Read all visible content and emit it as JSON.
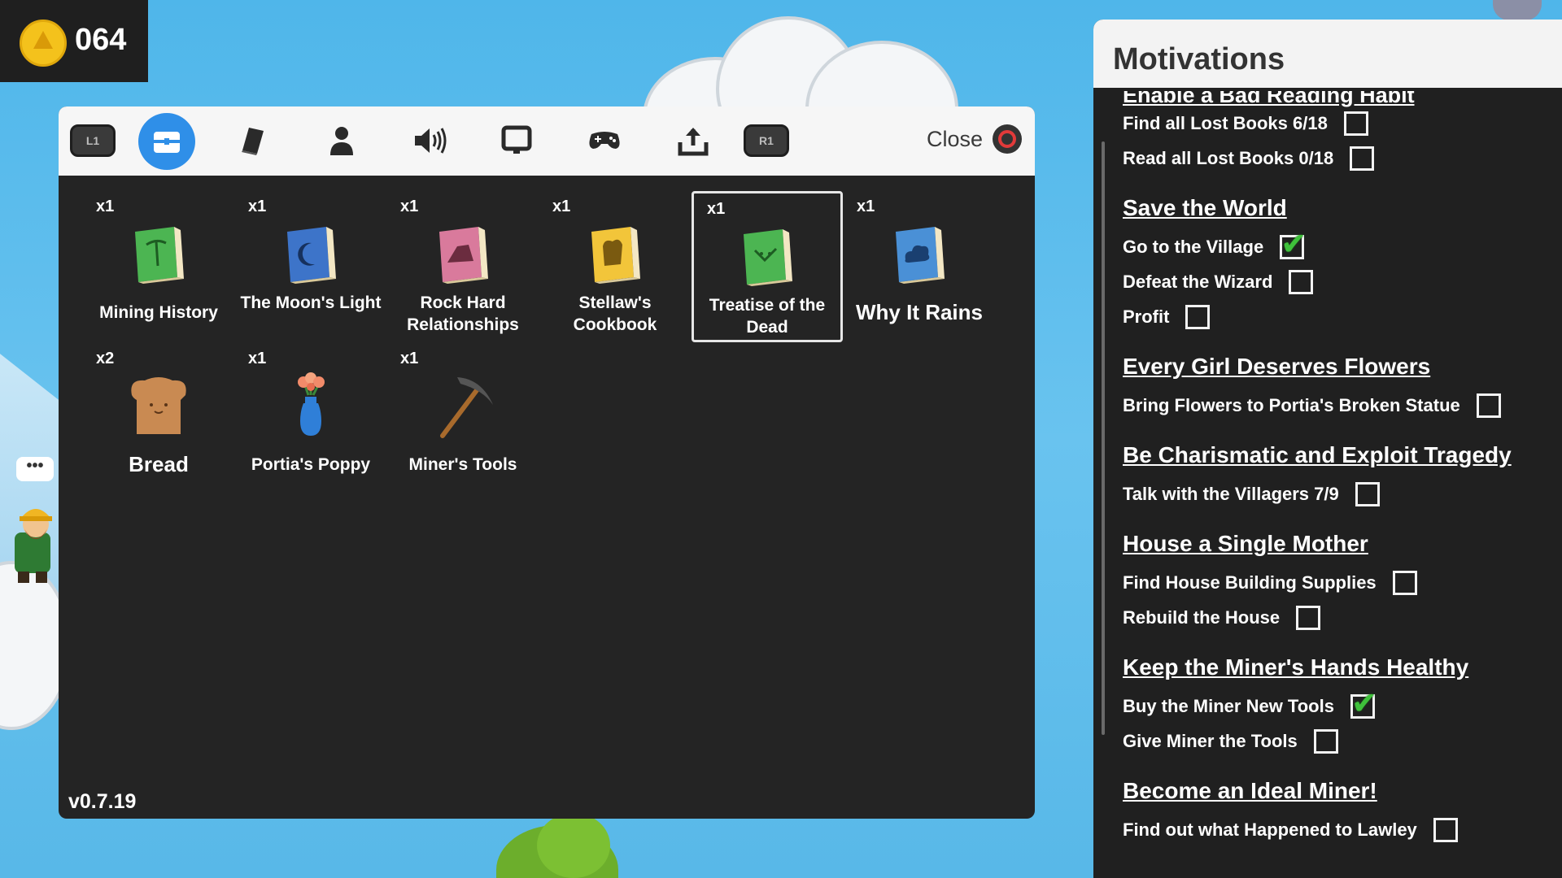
{
  "hud": {
    "coins": "064"
  },
  "tabs": [
    {
      "name": "L1",
      "icon": "l1-shoulder-icon"
    },
    {
      "name": "items",
      "icon": "chest-icon",
      "active": true
    },
    {
      "name": "notes",
      "icon": "book-icon"
    },
    {
      "name": "character",
      "icon": "person-icon"
    },
    {
      "name": "sound",
      "icon": "speaker-icon"
    },
    {
      "name": "display",
      "icon": "monitor-icon"
    },
    {
      "name": "controls",
      "icon": "gamepad-icon"
    },
    {
      "name": "export",
      "icon": "upload-icon"
    },
    {
      "name": "R1",
      "icon": "r1-shoulder-icon"
    }
  ],
  "shoulder": {
    "left": "L1",
    "right": "R1"
  },
  "close_label": "Close",
  "items": [
    {
      "qty": "x1",
      "name": "Mining History",
      "icon": "green-book-pickaxe"
    },
    {
      "qty": "x1",
      "name": "The Moon's Light",
      "icon": "blue-book-moon"
    },
    {
      "qty": "x1",
      "name": "Rock Hard Relationships",
      "icon": "pink-book-rock"
    },
    {
      "qty": "x1",
      "name": "Stellaw's Cookbook",
      "icon": "yellow-book-bread"
    },
    {
      "qty": "x1",
      "name": "Treatise of the Dead",
      "icon": "green-book-skull",
      "selected": true
    },
    {
      "qty": "x1",
      "name": "Why It Rains",
      "icon": "blue-book-cloud"
    },
    {
      "qty": "x2",
      "name": "Bread",
      "icon": "bread-icon"
    },
    {
      "qty": "x1",
      "name": "Portia's Poppy",
      "icon": "flower-vase-icon"
    },
    {
      "qty": "x1",
      "name": "Miner's Tools",
      "icon": "pickaxe-icon"
    }
  ],
  "version": "v0.7.19",
  "motivations": {
    "title": "Motivations",
    "partial_title": "Enable a Bad Reading Habit",
    "groups": [
      {
        "title": "",
        "tasks": [
          {
            "label": "Find all Lost Books 6/18",
            "done": false
          },
          {
            "label": "Read all Lost Books 0/18",
            "done": false
          }
        ]
      },
      {
        "title": "Save the World",
        "tasks": [
          {
            "label": "Go to the Village",
            "done": true
          },
          {
            "label": "Defeat the Wizard",
            "done": false
          },
          {
            "label": "Profit",
            "done": false
          }
        ]
      },
      {
        "title": "Every Girl Deserves Flowers",
        "tasks": [
          {
            "label": "Bring Flowers to Portia's Broken Statue",
            "done": false
          }
        ]
      },
      {
        "title": "Be Charismatic and Exploit Tragedy",
        "tasks": [
          {
            "label": "Talk with the Villagers 7/9",
            "done": false
          }
        ]
      },
      {
        "title": "House a Single Mother",
        "tasks": [
          {
            "label": "Find House Building Supplies",
            "done": false
          },
          {
            "label": "Rebuild the House",
            "done": false
          }
        ]
      },
      {
        "title": "Keep the Miner's Hands Healthy",
        "tasks": [
          {
            "label": "Buy the Miner New Tools",
            "done": true
          },
          {
            "label": "Give Miner the Tools",
            "done": false
          }
        ]
      },
      {
        "title": "Become an Ideal Miner!",
        "tasks": [
          {
            "label": "Find out what Happened to Lawley",
            "done": false
          }
        ]
      }
    ]
  },
  "chat_bubble": "•••"
}
